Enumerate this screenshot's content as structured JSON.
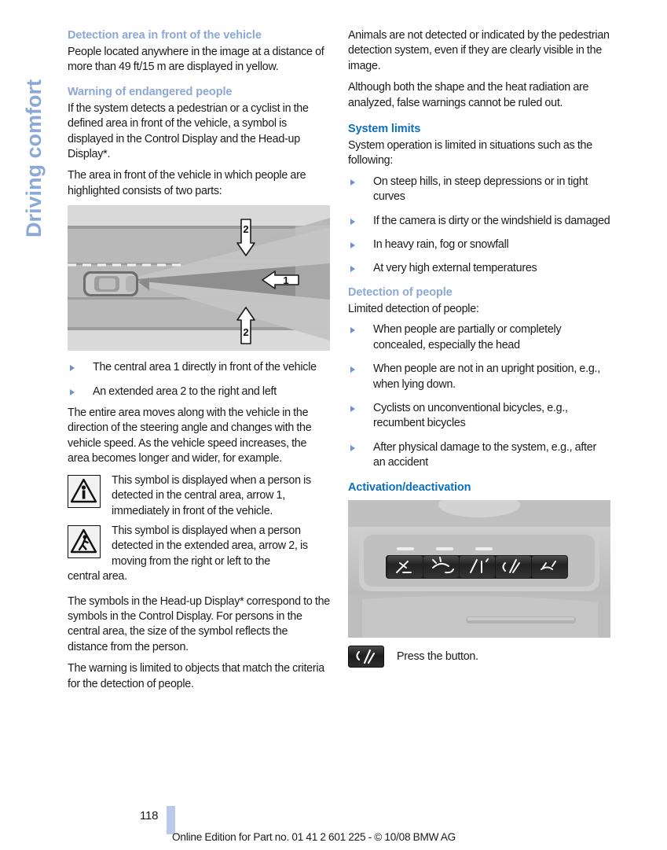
{
  "sidebar": {
    "chapter_label": "Driving comfort"
  },
  "left_column": {
    "heading_detection_area": "Detection area in front of the vehicle",
    "para_detection_area": "People located anywhere in the image at a distance of more than 49 ft/15 m are displayed in yellow.",
    "heading_warning": "Warning of endangered people",
    "para_warning_1": "If the system detects a pedestrian or a cyclist in the defined area in front of the vehicle, a symbol is displayed in the Control Display and the Head-up Display*.",
    "para_warning_2": "The area in front of the vehicle in which people are highlighted consists of two parts:",
    "diagram": {
      "name": "detection-area-road-diagram",
      "callout_central": "1",
      "callout_extended_top": "2",
      "callout_extended_bottom": "2"
    },
    "bullets_areas": [
      "The central area 1 directly in front of the vehicle",
      "An extended area 2 to the right and left"
    ],
    "para_area_moves": "The entire area moves along with the vehicle in the direction of the steering angle and changes with the vehicle speed. As the vehicle speed increases, the area becomes longer and wider, for example.",
    "symbol_central": {
      "icon_name": "warning-triangle-pedestrian-standing-icon",
      "text": "This symbol is displayed when a person is detected in the central area, arrow 1, immediately in front of the vehicle."
    },
    "symbol_extended": {
      "icon_name": "warning-triangle-pedestrian-walking-icon",
      "text": "This symbol is displayed when a person detected in the extended area, arrow 2, is moving from the right or left to the",
      "text_runon": "central area."
    },
    "para_hud": "The symbols in the Head-up Display* correspond to the symbols in the Control Display. For persons in the central area, the size of the symbol reflects the distance from the person.",
    "para_criteria": "The warning is limited to objects that match the criteria for the detection of people."
  },
  "right_column": {
    "para_animals": "Animals are not detected or indicated by the pedestrian detection system, even if they are clearly visible in the image.",
    "para_false_warnings": "Although both the shape and the heat radiation are analyzed, false warnings cannot be ruled out.",
    "heading_system_limits": "System limits",
    "para_system_limits": "System operation is limited in situations such as the following:",
    "bullets_system_limits": [
      "On steep hills, in steep depressions or in tight curves",
      "If the camera is dirty or the windshield is damaged",
      "In heavy rain, fog or snowfall",
      "At very high external temperatures"
    ],
    "heading_detection_people": "Detection of people",
    "para_detection_people": "Limited detection of people:",
    "bullets_detection_people": [
      "When people are partially or completely concealed, especially the head",
      "When people are not in an upright position, e.g., when lying down.",
      "Cyclists on unconventional bicycles, e.g., recumbent bicycles",
      "After physical damage to the system, e.g., after an accident"
    ],
    "heading_activation": "Activation/deactivation",
    "console_photo": {
      "name": "overhead-console-button-panel-photo",
      "buttons": [
        "roller-sunblind-icon",
        "night-vision-icon",
        "lane-departure-warning-icon",
        "pedestrian-detection-icon",
        "seat-function-icon"
      ]
    },
    "press_button": {
      "icon_name": "pedestrian-detection-button-icon",
      "label": "Press the button."
    }
  },
  "footer": {
    "page_number": "118",
    "edition_note": "Online Edition for Part no. 01 41 2 601 225 - © 10/08 BMW AG"
  },
  "colors": {
    "heading_light_blue": "#8ba8d6",
    "heading_dark_blue": "#0b6fbb",
    "bullet_marker": "#6f93cf",
    "footer_tab": "#b9c9e8",
    "body_text": "#1a1a1a"
  }
}
